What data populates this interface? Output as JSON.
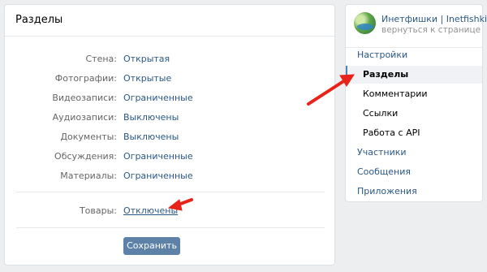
{
  "main": {
    "title": "Разделы",
    "settings": [
      {
        "label": "Стена:",
        "value": "Открытая"
      },
      {
        "label": "Фотографии:",
        "value": "Открытые"
      },
      {
        "label": "Видеозаписи:",
        "value": "Ограниченные"
      },
      {
        "label": "Аудиозаписи:",
        "value": "Выключены"
      },
      {
        "label": "Документы:",
        "value": "Выключены"
      },
      {
        "label": "Обсуждения:",
        "value": "Ограниченные"
      },
      {
        "label": "Материалы:",
        "value": "Ограниченные"
      }
    ],
    "goods": {
      "label": "Товары:",
      "value": "Отключены"
    },
    "save_label": "Сохранить"
  },
  "sidebar": {
    "group_name": "Инетфишки | Inetfishki.ru",
    "back_link": "вернуться к странице",
    "nav": [
      {
        "label": "Настройки"
      },
      {
        "label": "Разделы"
      },
      {
        "label": "Комментарии"
      },
      {
        "label": "Ссылки"
      },
      {
        "label": "Работа с API"
      },
      {
        "label": "Участники"
      },
      {
        "label": "Сообщения"
      },
      {
        "label": "Приложения"
      }
    ]
  },
  "colors": {
    "accent": "#5181b8",
    "link": "#2a5885",
    "annotation_arrow": "#e8231a"
  }
}
